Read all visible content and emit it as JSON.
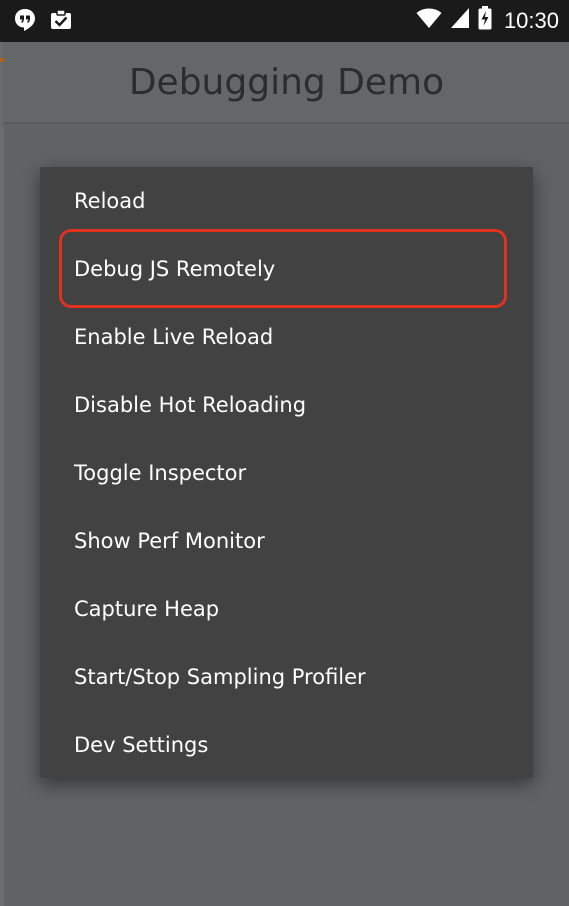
{
  "status_bar": {
    "left_icons": [
      "hangouts-icon",
      "clipboard-check-icon"
    ],
    "right_icons": [
      "wifi-icon",
      "cellular-signal-icon",
      "battery-charging-icon"
    ],
    "time": "10:30"
  },
  "app_bar": {
    "title": "Debugging Demo"
  },
  "dev_menu": {
    "items": [
      {
        "label": "Reload"
      },
      {
        "label": "Debug JS Remotely",
        "highlighted": true
      },
      {
        "label": "Enable Live Reload"
      },
      {
        "label": "Disable Hot Reloading"
      },
      {
        "label": "Toggle Inspector"
      },
      {
        "label": "Show Perf Monitor"
      },
      {
        "label": "Capture Heap"
      },
      {
        "label": "Start/Stop Sampling Profiler"
      },
      {
        "label": "Dev Settings"
      }
    ],
    "highlight_color": "#e0321e"
  },
  "colors": {
    "status_bar": "#1a1a1a",
    "app_bar": "#636767",
    "menu_bg": "#424242",
    "menu_text": "#ffffff",
    "title_text": "#2b2d2d"
  }
}
